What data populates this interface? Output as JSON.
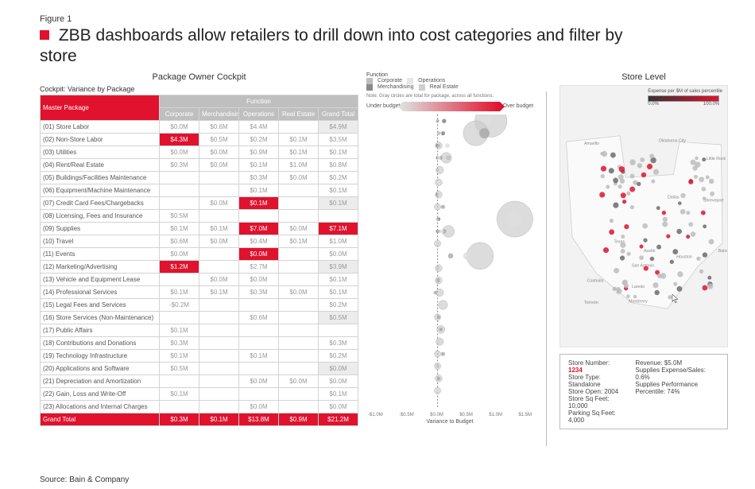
{
  "figure_label": "Figure 1",
  "title": "ZBB dashboards allow retailers to drill down into cost categories and filter by store",
  "source": "Source: Bain & Company",
  "cockpit": {
    "panel_title": "Package Owner Cockpit",
    "subtitle": "Cockpit: Variance by Package",
    "master_header": "Master Package",
    "function_header": "Function",
    "col_headers": [
      "Corporate",
      "Merchandising",
      "Operations",
      "Real Estate",
      "Grand Total"
    ],
    "rows": [
      {
        "label": "(01) Store Labor",
        "vals": [
          "$0.0M",
          "$0.6M",
          "$4.4M",
          "",
          "$4.9M"
        ],
        "hl": [],
        "gt": true
      },
      {
        "label": "(02) Non-Store Labor",
        "vals": [
          "$4.3M",
          "$0.5M",
          "$0.2M",
          "$0.1M",
          "$3.5M"
        ],
        "hl": [
          0
        ]
      },
      {
        "label": "(03) Utilities",
        "vals": [
          "$0.0M",
          "$0.0M",
          "$0.9M",
          "$0.1M",
          "$0.1M"
        ]
      },
      {
        "label": "(04) Rent/Real Estate",
        "vals": [
          "$0.3M",
          "$0.0M",
          "$0.1M",
          "$1.0M",
          "$0.8M"
        ]
      },
      {
        "label": "(05) Buildings/Facilities Maintenance",
        "vals": [
          "",
          "",
          "$0.3M",
          "$0.0M",
          "$0.2M"
        ]
      },
      {
        "label": "(06) Equipment/Machine Maintenance",
        "vals": [
          "",
          "",
          "$0.1M",
          "",
          "$0.1M"
        ]
      },
      {
        "label": "(07) Credit Card Fees/Chargebacks",
        "vals": [
          "",
          "$0.0M",
          "$0.1M",
          "",
          "$0.1M"
        ],
        "hl": [
          2
        ],
        "gt": true
      },
      {
        "label": "(08) Licensing, Fees and Insurance",
        "vals": [
          "$0.5M",
          "",
          "",
          "",
          ""
        ]
      },
      {
        "label": "(09) Supplies",
        "vals": [
          "$0.1M",
          "$0.1M",
          "$7.0M",
          "$0.0M",
          "$7.1M"
        ],
        "hl": [
          2,
          4
        ]
      },
      {
        "label": "(10) Travel",
        "vals": [
          "$0.6M",
          "$0.0M",
          "$0.4M",
          "$0.1M",
          "$1.0M"
        ]
      },
      {
        "label": "(11) Events",
        "vals": [
          "$0.0M",
          "",
          "$0.0M",
          "",
          "$0.0M"
        ],
        "hl": [
          2
        ]
      },
      {
        "label": "(12) Marketing/Advertising",
        "vals": [
          "$1.2M",
          "",
          "$2.7M",
          "",
          "$3.9M"
        ],
        "hl": [
          0
        ],
        "gt": true
      },
      {
        "label": "(13) Vehicle and Equipment Lease",
        "vals": [
          "",
          "$0.0M",
          "$0.0M",
          "",
          "$0.1M"
        ]
      },
      {
        "label": "(14) Professional Services",
        "vals": [
          "$0.1M",
          "$0.1M",
          "$0.3M",
          "$0.0M",
          "$0.1M"
        ]
      },
      {
        "label": "(15) Legal Fees and Services",
        "vals": [
          "-$0.2M",
          "",
          "",
          "",
          "$0.2M"
        ]
      },
      {
        "label": "(16) Store Services (Non-Maintenance)",
        "vals": [
          "",
          "",
          "$0.6M",
          "",
          "$0.5M"
        ],
        "gt": true
      },
      {
        "label": "(17) Public Affairs",
        "vals": [
          "$0.1M",
          "",
          "",
          "",
          ""
        ]
      },
      {
        "label": "(18) Contributions and Donations",
        "vals": [
          "$0.3M",
          "",
          "",
          "",
          "$0.3M"
        ]
      },
      {
        "label": "(19) Technology Infrastructure",
        "vals": [
          "$0.1M",
          "",
          "$0.1M",
          "",
          "$0.2M"
        ]
      },
      {
        "label": "(20) Applications and Software",
        "vals": [
          "$0.5M",
          "",
          "",
          "",
          "$0.0M"
        ],
        "gt": true
      },
      {
        "label": "(21) Depreciation and Amortization",
        "vals": [
          "",
          "",
          "$0.0M",
          "$0.0M",
          "$0.0M"
        ]
      },
      {
        "label": "(22) Gain, Loss and Write-Off",
        "vals": [
          "$0.1M",
          "",
          "",
          "",
          "$0.1M"
        ]
      },
      {
        "label": "(23) Allocations and Internal Charges",
        "vals": [
          "",
          "",
          "$0.0M",
          "",
          "$0.0M"
        ]
      }
    ],
    "grand_label": "Grand Total",
    "grand_vals": [
      "$0.3M",
      "$0.1M",
      "$13.8M",
      "$0.9M",
      "$21.2M"
    ]
  },
  "bubble": {
    "function_label": "Function",
    "legend": [
      "Corporate",
      "Merchandising",
      "Operations",
      "Real Estate"
    ],
    "note": "Note: Gray circles are total for package, across all functions.",
    "under": "Under budget",
    "over": "Over budget",
    "x_ticks": [
      "-$1.0M",
      "-$0.5M",
      "$0.0M",
      "$0.5M",
      "$1.0M",
      "$1.5M"
    ],
    "x_title": "Variance to Budget"
  },
  "map": {
    "panel_title": "Store Level",
    "legend_title": "Expense per $M of sales percentile",
    "legend_min": "0.0%",
    "legend_max": "100.0%",
    "labels": [
      "Amarillo",
      "Oklahoma City",
      "Little Rock",
      "Dallas",
      "Shreveport",
      "Texas",
      "Austin",
      "Houston",
      "Baton",
      "San Antonio",
      "Laredo",
      "Coahuila",
      "Monterrey",
      "Torreón"
    ]
  },
  "store_card": {
    "num_label": "Store Number:",
    "num": "1234",
    "type_label": "Store Type:",
    "type": "Standalone",
    "open_label": "Store Open:",
    "open": "2004",
    "sqft_label": "Store Sq Feet:",
    "sqft": "10,000",
    "park_label": "Parking Sq Feet:",
    "park": "4,000",
    "rev_label": "Revenue:",
    "rev": "$5.0M",
    "exp_label": "Supplies Expense/Sales:",
    "exp": "0.6%",
    "perf_label": "Supplies Performance Percentile:",
    "perf": "74%"
  },
  "chart_data": {
    "type": "table",
    "title": "Cockpit: Variance by Package ($M)",
    "columns": [
      "Corporate",
      "Merchandising",
      "Operations",
      "Real Estate",
      "Grand Total"
    ],
    "categories": [
      "(01) Store Labor",
      "(02) Non-Store Labor",
      "(03) Utilities",
      "(04) Rent/Real Estate",
      "(05) Buildings/Facilities Maintenance",
      "(06) Equipment/Machine Maintenance",
      "(07) Credit Card Fees/Chargebacks",
      "(08) Licensing, Fees and Insurance",
      "(09) Supplies",
      "(10) Travel",
      "(11) Events",
      "(12) Marketing/Advertising",
      "(13) Vehicle and Equipment Lease",
      "(14) Professional Services",
      "(15) Legal Fees and Services",
      "(16) Store Services (Non-Maintenance)",
      "(17) Public Affairs",
      "(18) Contributions and Donations",
      "(19) Technology Infrastructure",
      "(20) Applications and Software",
      "(21) Depreciation and Amortization",
      "(22) Gain, Loss and Write-Off",
      "(23) Allocations and Internal Charges",
      "Grand Total"
    ],
    "data": [
      [
        0.0,
        0.6,
        4.4,
        null,
        4.9
      ],
      [
        4.3,
        0.5,
        0.2,
        0.1,
        3.5
      ],
      [
        0.0,
        0.0,
        0.9,
        0.1,
        0.1
      ],
      [
        0.3,
        0.0,
        0.1,
        1.0,
        0.8
      ],
      [
        null,
        null,
        0.3,
        0.0,
        0.2
      ],
      [
        null,
        null,
        0.1,
        null,
        0.1
      ],
      [
        null,
        0.0,
        0.1,
        null,
        0.1
      ],
      [
        0.5,
        null,
        null,
        null,
        null
      ],
      [
        0.1,
        0.1,
        7.0,
        0.0,
        7.1
      ],
      [
        0.6,
        0.0,
        0.4,
        0.1,
        1.0
      ],
      [
        0.0,
        null,
        0.0,
        null,
        0.0
      ],
      [
        1.2,
        null,
        2.7,
        null,
        3.9
      ],
      [
        null,
        0.0,
        0.0,
        null,
        0.1
      ],
      [
        0.1,
        0.1,
        0.3,
        0.0,
        0.1
      ],
      [
        -0.2,
        null,
        null,
        null,
        0.2
      ],
      [
        null,
        null,
        0.6,
        null,
        0.5
      ],
      [
        0.1,
        null,
        null,
        null,
        null
      ],
      [
        0.3,
        null,
        null,
        null,
        0.3
      ],
      [
        0.1,
        null,
        0.1,
        null,
        0.2
      ],
      [
        0.5,
        null,
        null,
        null,
        0.0
      ],
      [
        null,
        null,
        0.0,
        0.0,
        0.0
      ],
      [
        0.1,
        null,
        null,
        null,
        0.1
      ],
      [
        null,
        null,
        0.0,
        null,
        0.0
      ],
      [
        0.3,
        0.1,
        13.8,
        0.9,
        21.2
      ]
    ],
    "xlabel": "Variance to Budget",
    "x_range": [
      -1.0,
      1.5
    ],
    "grand_total": {
      "Corporate": 0.3,
      "Merchandising": 0.1,
      "Operations": 13.8,
      "Real Estate": 0.9,
      "Grand Total": 21.2
    }
  }
}
